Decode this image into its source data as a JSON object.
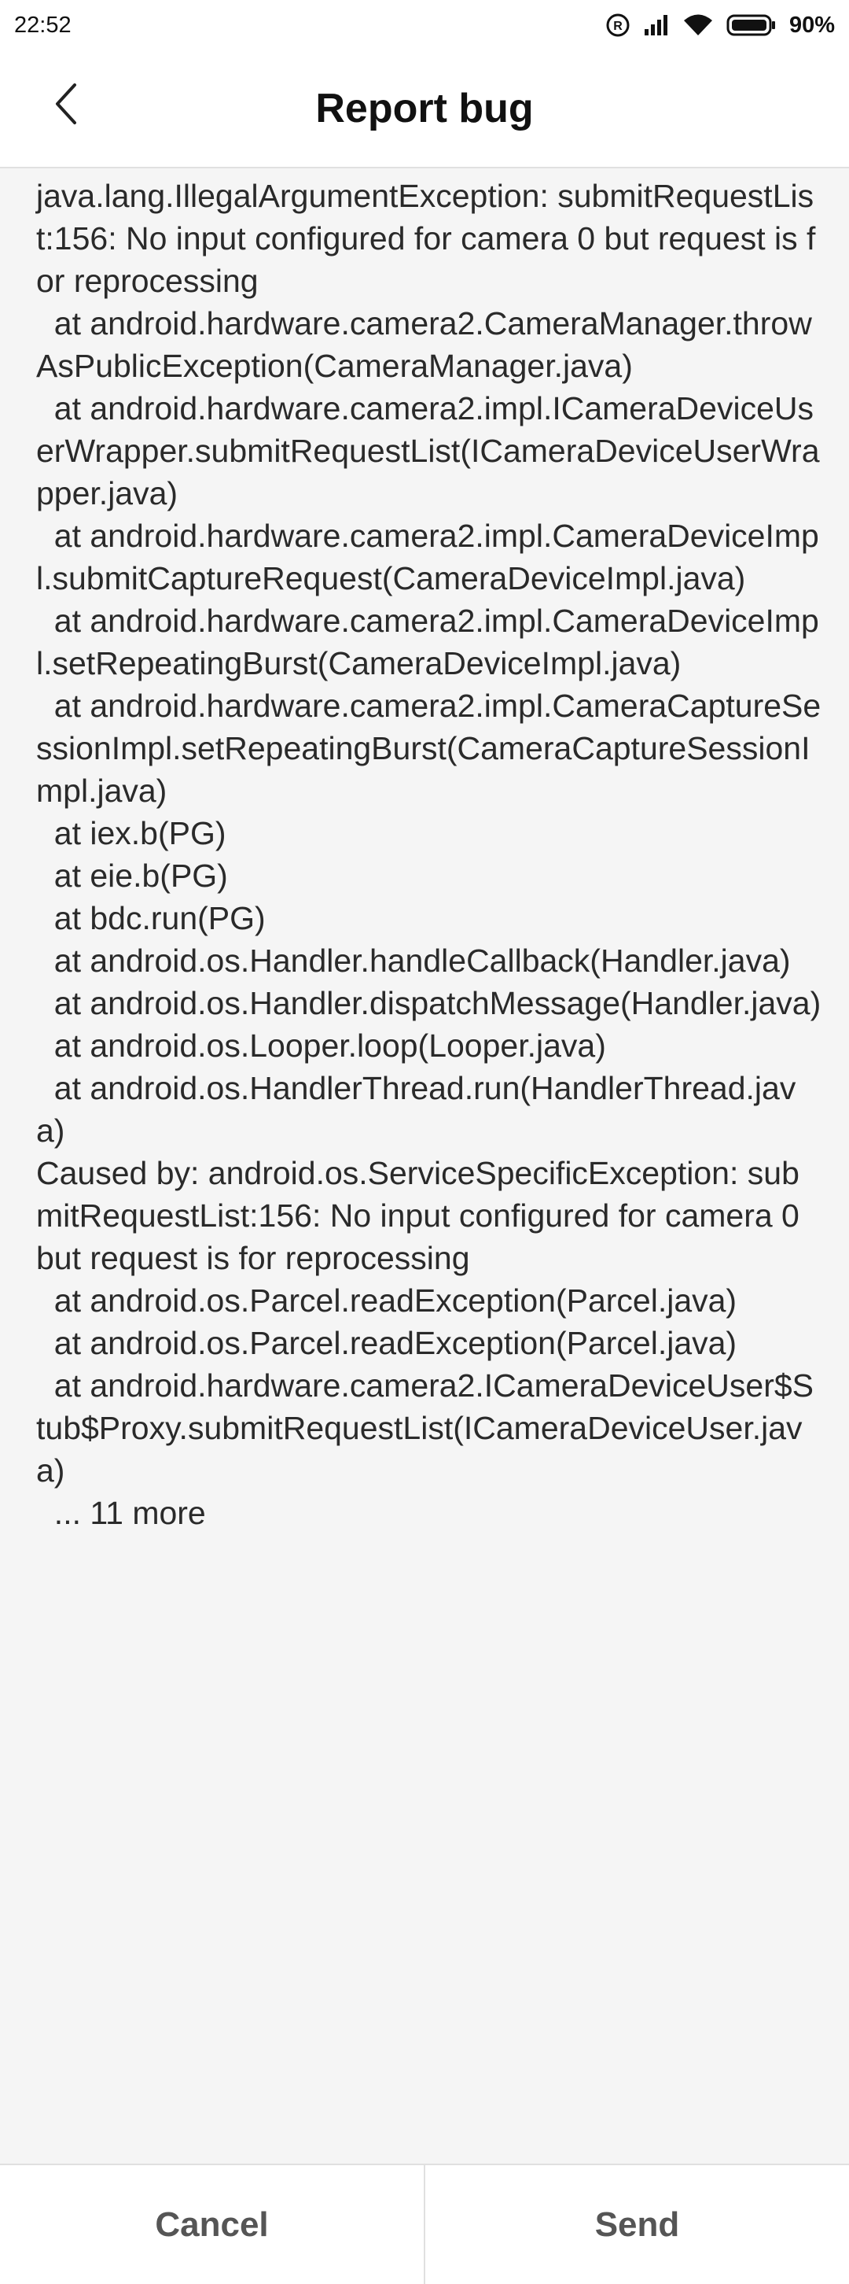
{
  "status_bar": {
    "time": "22:52",
    "battery_percent": "90%",
    "icons": [
      "registered-icon",
      "signal-icon",
      "wifi-icon",
      "battery-icon"
    ]
  },
  "header": {
    "title": "Report bug",
    "back_icon": "chevron-left-icon"
  },
  "log": {
    "text": "java.lang.IllegalArgumentException: submitRequestList:156: No input configured for camera 0 but request is for reprocessing\n  at android.hardware.camera2.CameraManager.throwAsPublicException(CameraManager.java)\n  at android.hardware.camera2.impl.ICameraDeviceUserWrapper.submitRequestList(ICameraDeviceUserWrapper.java)\n  at android.hardware.camera2.impl.CameraDeviceImpl.submitCaptureRequest(CameraDeviceImpl.java)\n  at android.hardware.camera2.impl.CameraDeviceImpl.setRepeatingBurst(CameraDeviceImpl.java)\n  at android.hardware.camera2.impl.CameraCaptureSessionImpl.setRepeatingBurst(CameraCaptureSessionImpl.java)\n  at iex.b(PG)\n  at eie.b(PG)\n  at bdc.run(PG)\n  at android.os.Handler.handleCallback(Handler.java)\n  at android.os.Handler.dispatchMessage(Handler.java)\n  at android.os.Looper.loop(Looper.java)\n  at android.os.HandlerThread.run(HandlerThread.java)\nCaused by: android.os.ServiceSpecificException: submitRequestList:156: No input configured for camera 0 but request is for reprocessing\n  at android.os.Parcel.readException(Parcel.java)\n  at android.os.Parcel.readException(Parcel.java)\n  at android.hardware.camera2.ICameraDeviceUser$Stub$Proxy.submitRequestList(ICameraDeviceUser.java)\n  ... 11 more"
  },
  "footer": {
    "cancel_label": "Cancel",
    "send_label": "Send"
  },
  "colors": {
    "content_background": "#f5f5f5",
    "text": "#2a2a2a",
    "button_text": "#555555",
    "divider": "#e0e0e0"
  }
}
